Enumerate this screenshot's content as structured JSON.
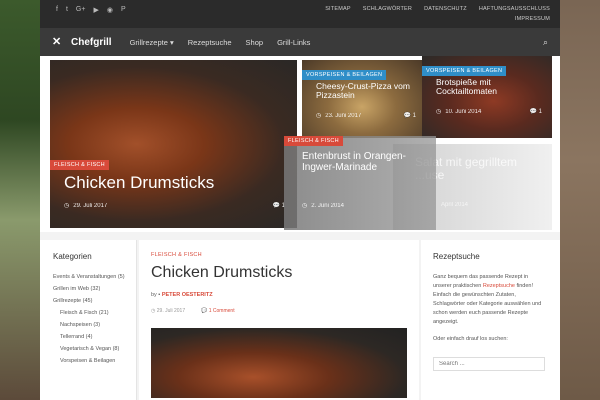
{
  "topbar": {
    "social_icons": [
      "facebook-icon",
      "twitter-icon",
      "google-plus-icon",
      "youtube-icon",
      "rss-icon",
      "pinterest-icon"
    ],
    "links": [
      "Sitemap",
      "Schlagwörter",
      "Datenschutz",
      "Haftungsausschluss",
      "Impressum"
    ]
  },
  "nav": {
    "logo": "Chefgrill",
    "items": [
      "Grillrezepte ▾",
      "Rezeptsuche",
      "Shop",
      "Grill-Links"
    ]
  },
  "hero": {
    "main": {
      "category": "Fleisch & Fisch",
      "title": "Chicken Drumsticks",
      "date": "29. Juli 2017",
      "comments": "1"
    },
    "pizza": {
      "category": "Vorspeisen & Beilagen",
      "title": "Cheesy-Crust-Pizza vom Pizzastein",
      "date": "23. Juni 2017",
      "comments": "1"
    },
    "spiess": {
      "category": "Vorspeisen & Beilagen",
      "title": "Brotspieße mit Cocktailtomaten",
      "date": "10. Juni 2014",
      "comments": "1"
    },
    "ente": {
      "category": "Fleisch & Fisch",
      "title": "Entenbrust in Orangen-Ingwer-Marinade",
      "date": "2. Juni 2014"
    },
    "salat": {
      "title": "Salat mit gegrilltem ...use",
      "date": "April 2014"
    }
  },
  "left": {
    "heading": "Kategorien",
    "items": [
      {
        "label": "Events & Veranstaltungen (5)"
      },
      {
        "label": "Grillen im Web (32)"
      },
      {
        "label": "Grillrezepte (45)"
      },
      {
        "label": "Fleisch & Fisch (21)"
      },
      {
        "label": "Nachspeisen (3)"
      },
      {
        "label": "Tellerrand (4)"
      },
      {
        "label": "Vegetarisch & Vegan (8)"
      },
      {
        "label": "Vorspeisen & Beilagen"
      }
    ]
  },
  "center": {
    "category": "Fleisch & Fisch",
    "title": "Chicken Drumsticks",
    "by": "by",
    "author": "Peter Oesteritz",
    "date": "29. Juli 2017",
    "comments": "1 Comment"
  },
  "right": {
    "heading": "Rezeptsuche",
    "text_before": "Ganz bequem das passende Rezept in unserer praktischen",
    "link": "Rezeptsuche",
    "text_after": "finden! Einfach die gewünschten Zutaten, Schlagwörter oder Kategorie auswählen und schon werden euch passende Rezepte angezeigt.",
    "text2": "Oder einfach drauf los suchen:",
    "search_placeholder": "Search ..."
  }
}
